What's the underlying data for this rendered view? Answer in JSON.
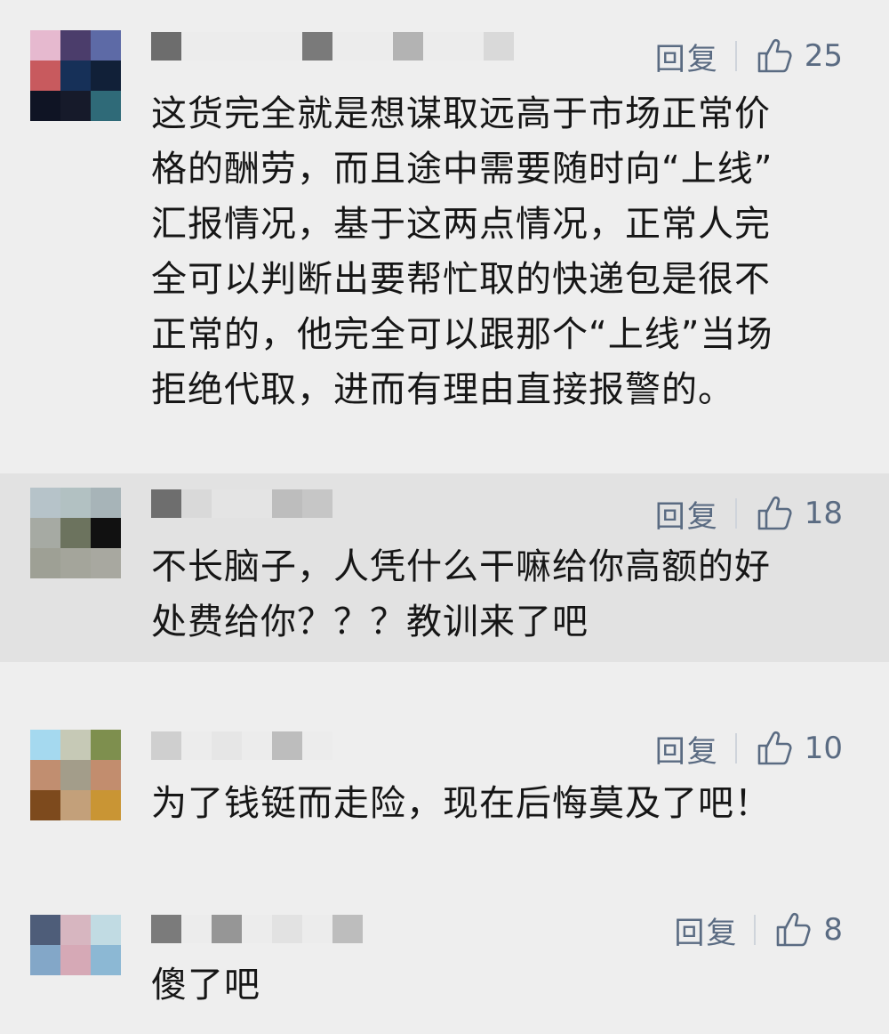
{
  "comments": [
    {
      "reply_label": "回复",
      "likes": "25",
      "text": "这货完全就是想谋取远高于市场正常价\n格的酬劳，而且途中需要随时向“上线”\n汇报情况，基于这两点情况，正常人完\n全可以判断出要帮忙取的快递包是很不\n正常的，他完全可以跟那个“上线”当场\n拒绝代取，进而有理由直接报警的。",
      "avatar_colors": [
        "#e6b9cf",
        "#4b3d6b",
        "#5d6aa6",
        "#c85a5e",
        "#163058",
        "#112038",
        "#0f1424",
        "#161a2a",
        "#2f6a78"
      ],
      "name_colors": [
        "#6d6d6d",
        "#ececec",
        "#ececec",
        "#ececec",
        "#ececec",
        "#7a7a7a",
        "#ececec",
        "#ececec",
        "#b3b3b3",
        "#ececec",
        "#ececec",
        "#d9d9d9"
      ]
    },
    {
      "reply_label": "回复",
      "likes": "18",
      "text": "不长脑子，人凭什么干嘛给你高额的好\n处费给你？？？教训来了吧",
      "avatar_colors": [
        "#b6c3c9",
        "#b2c1c2",
        "#a7b4b8",
        "#a6aaa3",
        "#6c735e",
        "#111111",
        "#9ea095",
        "#a4a59b",
        "#a8a8a0"
      ],
      "name_colors": [
        "#6e6e6e",
        "#d9d9d9",
        "#e4e4e4",
        "#e4e4e4",
        "#bdbdbd",
        "#c6c6c6"
      ]
    },
    {
      "reply_label": "回复",
      "likes": "10",
      "text": "为了钱铤而走险，现在后悔莫及了吧！",
      "avatar_colors": [
        "#a5d9ef",
        "#c6c9b6",
        "#7e8f4e",
        "#c18e70",
        "#a39d8a",
        "#c28d6e",
        "#7d4a1d",
        "#c3a07a",
        "#c99534"
      ],
      "name_colors": [
        "#cfcfcf",
        "#ececec",
        "#e6e6e6",
        "#ececec",
        "#bdbdbd",
        "#ececec"
      ]
    },
    {
      "reply_label": "回复",
      "likes": "8",
      "text": "傻了吧",
      "avatar_colors": [
        "#4e5d79",
        "#d7b6c0",
        "#c1dbe3",
        "#83a7c8",
        "#d6a9b6",
        "#8cb8d4",
        "#eeeeee",
        "#eeeeee",
        "#eeeeee"
      ],
      "name_colors": [
        "#7b7b7b",
        "#ececec",
        "#969696",
        "#ececec",
        "#e2e2e2",
        "#ececec",
        "#bdbdbd"
      ]
    }
  ],
  "colors": {
    "background": "#eeeeee",
    "highlight_background": "#e2e2e2",
    "action_text": "#5a6b82",
    "body_text": "#161616"
  },
  "icons": [
    "thumbs-up-icon"
  ]
}
